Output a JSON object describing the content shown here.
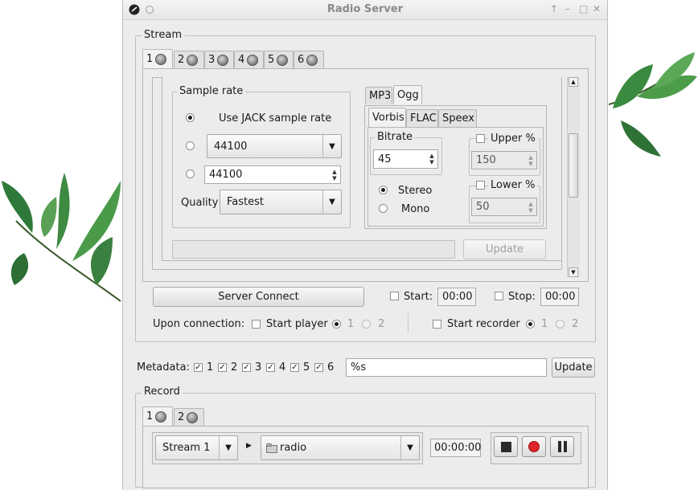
{
  "window": {
    "title": "Radio Server"
  },
  "stream": {
    "label": "Stream",
    "tabs": [
      "1",
      "2",
      "3",
      "4",
      "5",
      "6"
    ],
    "sample_rate": {
      "label": "Sample rate",
      "use_jack_label": "Use JACK sample rate",
      "preset_value": "44100",
      "custom_value": "44100",
      "quality_label": "Quality",
      "quality_value": "Fastest"
    },
    "codec_tabs": [
      "MP3",
      "Ogg"
    ],
    "ogg_tabs": [
      "Vorbis",
      "FLAC",
      "Speex"
    ],
    "bitrate": {
      "label": "Bitrate",
      "value": "45"
    },
    "upper": {
      "label": "Upper %",
      "value": "150"
    },
    "lower": {
      "label": "Lower %",
      "value": "50"
    },
    "stereo_label": "Stereo",
    "mono_label": "Mono",
    "update_label": "Update",
    "server_connect_label": "Server Connect",
    "start_label": "Start:",
    "start_time": "00:00",
    "stop_label": "Stop:",
    "stop_time": "00:00",
    "upon_connection_label": "Upon connection:",
    "start_player_label": "Start player",
    "start_recorder_label": "Start recorder",
    "opt1": "1",
    "opt2": "2"
  },
  "metadata": {
    "label": "Metadata:",
    "checks": [
      "1",
      "2",
      "3",
      "4",
      "5",
      "6"
    ],
    "value": "%s",
    "update_label": "Update"
  },
  "record": {
    "label": "Record",
    "tabs": [
      "1",
      "2"
    ],
    "source_value": "Stream  1",
    "file_value": "radio",
    "time": "00:00:00"
  },
  "icons": [
    "app-icon",
    "led-indicator-icon",
    "folder-icon",
    "stop-icon",
    "record-icon",
    "pause-icon",
    "play-arrow-icon"
  ]
}
